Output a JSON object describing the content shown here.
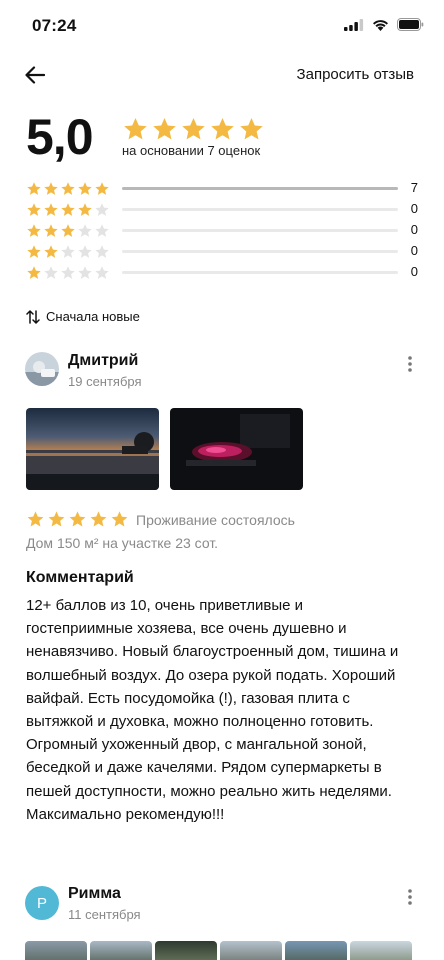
{
  "status_bar": {
    "time": "07:24"
  },
  "header": {
    "back_icon": "arrow-left-icon",
    "request_review_label": "Запросить отзыв"
  },
  "rating": {
    "score": "5,0",
    "stars": 5,
    "basis_text": "на основании 7 оценок",
    "star_color": "#f4b942",
    "distribution": [
      {
        "stars": 5,
        "count": "7",
        "fraction": 1.0
      },
      {
        "stars": 4,
        "count": "0",
        "fraction": 0
      },
      {
        "stars": 3,
        "count": "0",
        "fraction": 0
      },
      {
        "stars": 2,
        "count": "0",
        "fraction": 0
      },
      {
        "stars": 1,
        "count": "0",
        "fraction": 0
      }
    ]
  },
  "sort": {
    "icon": "sort-arrows-icon",
    "label": "Сначала новые"
  },
  "reviews": [
    {
      "name": "Дмитрий",
      "date": "19 сентября",
      "photos": [
        "sunset-lake-photo",
        "grill-coals-photo"
      ],
      "stars": 5,
      "stay_label": "Проживание состоялось",
      "property": "Дом 150 м² на участке 23 сот.",
      "comment_title": "Комментарий",
      "comment": "12+ баллов из 10, очень приветливые и гостеприимные хозяева, все очень душевно и ненавязчиво. Новый благоустроенный дом, тишина и волшебный воздух. До озера рукой подать. Хороший вайфай. Есть посудомойка (!), газовая плита с вытяжкой и духовка, можно полноценно готовить. Огромный ухоженный двор, с мангальной зоной, беседкой и даже качелями. Рядом супермаркеты в пешей доступности, можно реально жить неделями. Максимально рекомендую!!!"
    },
    {
      "name": "Римма",
      "initial": "Р",
      "date": "11 сентября",
      "avatar_color": "#51b9d6",
      "photos": [
        "photo-1",
        "photo-2",
        "photo-3",
        "photo-4",
        "photo-5",
        "photo-6",
        "photo-7"
      ]
    }
  ]
}
